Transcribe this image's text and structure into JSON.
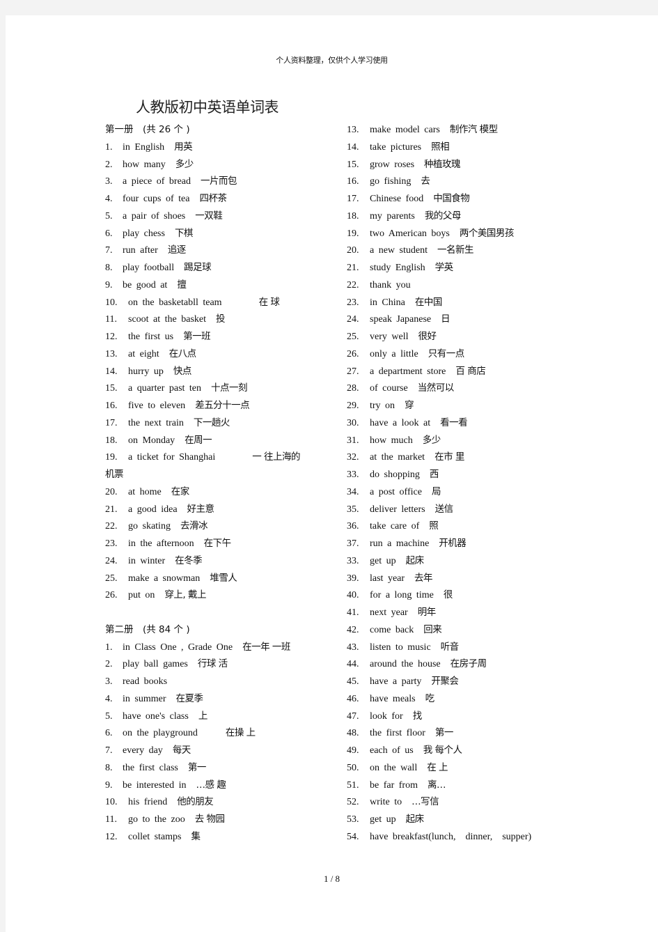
{
  "header_note": "个人资料整理，仅供个人学习使用",
  "title": "人教版初中英语单词表",
  "left_column": [
    {
      "type": "heading",
      "text": "第一册　(共 26 个 )"
    },
    {
      "type": "item",
      "num": "1.",
      "en": "in English",
      "zh": "用英"
    },
    {
      "type": "item",
      "num": "2.",
      "en": "how many",
      "zh": "多少"
    },
    {
      "type": "item",
      "num": "3.",
      "en": "a piece of bread",
      "zh": "一片而包"
    },
    {
      "type": "item",
      "num": "4.",
      "en": "four cups of tea",
      "zh": "四杯茶"
    },
    {
      "type": "item",
      "num": "5.",
      "en": "a pair of shoes",
      "zh": "一双鞋"
    },
    {
      "type": "item",
      "num": "6.",
      "en": "play chess",
      "zh": "下棋"
    },
    {
      "type": "item",
      "num": "7.",
      "en": "run after",
      "zh": "追逐"
    },
    {
      "type": "item",
      "num": "8.",
      "en": "play football",
      "zh": "踢足球"
    },
    {
      "type": "item",
      "num": "9.",
      "en": "be good at",
      "zh": "擅"
    },
    {
      "type": "item",
      "num": "10.",
      "en": "on the basketabll team",
      "zh": "　　　在 球"
    },
    {
      "type": "item",
      "num": "11.",
      "en": "scoot at the basket",
      "zh": "投"
    },
    {
      "type": "item",
      "num": "12.",
      "en": "the first us",
      "zh": "第一班"
    },
    {
      "type": "item",
      "num": "13.",
      "en": "at eight",
      "zh": "在八点"
    },
    {
      "type": "item",
      "num": "14.",
      "en": "hurry up",
      "zh": "快点"
    },
    {
      "type": "item",
      "num": "15.",
      "en": "a quarter past ten",
      "zh": "十点一刻"
    },
    {
      "type": "item",
      "num": "16.",
      "en": "five to eleven",
      "zh": "差五分十一点"
    },
    {
      "type": "item",
      "num": "17.",
      "en": "the next train",
      "zh": "下一趟火"
    },
    {
      "type": "item",
      "num": "18.",
      "en": "on Monday",
      "zh": "在周一"
    },
    {
      "type": "item",
      "num": "19.",
      "en": "a ticket for Shanghai",
      "zh": "　　　一 往上海的"
    },
    {
      "type": "continuation",
      "text": "机票"
    },
    {
      "type": "item",
      "num": "20.",
      "en": "at home",
      "zh": "在家"
    },
    {
      "type": "item",
      "num": "21.",
      "en": "a good idea",
      "zh": "好主意"
    },
    {
      "type": "item",
      "num": "22.",
      "en": "go skating",
      "zh": "去滑冰"
    },
    {
      "type": "item",
      "num": "23.",
      "en": "in the afternoon",
      "zh": "在下午"
    },
    {
      "type": "item",
      "num": "24.",
      "en": "in winter",
      "zh": "在冬季"
    },
    {
      "type": "item",
      "num": "25.",
      "en": "make a snowman",
      "zh": "堆雪人"
    },
    {
      "type": "item",
      "num": "26.",
      "en": "put on",
      "zh": "穿上, 戴上"
    },
    {
      "type": "blank",
      "text": ""
    },
    {
      "type": "heading",
      "text": "第二册　(共 84 个 )"
    },
    {
      "type": "item",
      "num": "1.",
      "en": "in Class One , Grade One",
      "zh": "在一年 一班"
    },
    {
      "type": "item",
      "num": "2.",
      "en": "play ball games",
      "zh": "行球 活"
    },
    {
      "type": "item",
      "num": "3.",
      "en": "read books",
      "zh": ""
    },
    {
      "type": "item",
      "num": "4.",
      "en": "in summer",
      "zh": "在夏季"
    },
    {
      "type": "item",
      "num": "5.",
      "en": "have one's class",
      "zh": "上"
    },
    {
      "type": "item",
      "num": "6.",
      "en": "on the playground",
      "zh": "　　在操 上"
    },
    {
      "type": "item",
      "num": "7.",
      "en": "every day",
      "zh": "每天"
    },
    {
      "type": "item",
      "num": "8.",
      "en": "the first class",
      "zh": "第一"
    },
    {
      "type": "item",
      "num": "9.",
      "en": "be interested in",
      "zh": "…感 趣"
    },
    {
      "type": "item",
      "num": "10.",
      "en": "his friend",
      "zh": "他的朋友"
    },
    {
      "type": "item",
      "num": "11.",
      "en": "go to the zoo",
      "zh": "去 物园"
    },
    {
      "type": "item",
      "num": "12.",
      "en": "collet stamps",
      "zh": "集"
    }
  ],
  "right_column": [
    {
      "type": "item",
      "num": "13.",
      "en": "make model cars",
      "zh": "制作汽 模型"
    },
    {
      "type": "item",
      "num": "14.",
      "en": "take pictures",
      "zh": "照相"
    },
    {
      "type": "item",
      "num": "15.",
      "en": "grow roses",
      "zh": "种植玫瑰"
    },
    {
      "type": "item",
      "num": "16.",
      "en": "go fishing",
      "zh": "去"
    },
    {
      "type": "item",
      "num": "17.",
      "en": "Chinese food",
      "zh": "中国食物"
    },
    {
      "type": "item",
      "num": "18.",
      "en": "my parents",
      "zh": "我的父母"
    },
    {
      "type": "item",
      "num": "19.",
      "en": "two American boys",
      "zh": "两个美国男孩"
    },
    {
      "type": "item",
      "num": "20.",
      "en": "a new student",
      "zh": "一名新生"
    },
    {
      "type": "item",
      "num": "21.",
      "en": "study English",
      "zh": "学英"
    },
    {
      "type": "item",
      "num": "22.",
      "en": "thank you",
      "zh": ""
    },
    {
      "type": "item",
      "num": "23.",
      "en": "in China",
      "zh": "在中国"
    },
    {
      "type": "item",
      "num": "24.",
      "en": "speak Japanese",
      "zh": "日"
    },
    {
      "type": "item",
      "num": "25.",
      "en": "very well",
      "zh": "很好"
    },
    {
      "type": "item",
      "num": "26.",
      "en": "only a little",
      "zh": "只有一点"
    },
    {
      "type": "item",
      "num": "27.",
      "en": "a department store",
      "zh": "百 商店"
    },
    {
      "type": "item",
      "num": "28.",
      "en": "of course",
      "zh": "当然可以"
    },
    {
      "type": "item",
      "num": "29.",
      "en": "try on",
      "zh": "穿"
    },
    {
      "type": "item",
      "num": "30.",
      "en": "have a look at",
      "zh": "看一看"
    },
    {
      "type": "item",
      "num": "31.",
      "en": "how much",
      "zh": "多少"
    },
    {
      "type": "item",
      "num": "32.",
      "en": "at the market",
      "zh": "在市 里"
    },
    {
      "type": "item",
      "num": "33.",
      "en": "do shopping",
      "zh": "西"
    },
    {
      "type": "item",
      "num": "34.",
      "en": "a post office",
      "zh": "局"
    },
    {
      "type": "item",
      "num": "35.",
      "en": "deliver letters",
      "zh": "送信"
    },
    {
      "type": "item",
      "num": "36.",
      "en": "take care of",
      "zh": "照"
    },
    {
      "type": "item",
      "num": "37.",
      "en": "run a machine",
      "zh": "开机器"
    },
    {
      "type": "item",
      "num": "33.",
      "en": "get up",
      "zh": "起床"
    },
    {
      "type": "item",
      "num": "39.",
      "en": "last year",
      "zh": "去年"
    },
    {
      "type": "item",
      "num": "40.",
      "en": "for a long time",
      "zh": "很"
    },
    {
      "type": "item",
      "num": "41.",
      "en": "next year",
      "zh": "明年"
    },
    {
      "type": "item",
      "num": "42.",
      "en": "come back",
      "zh": "回来"
    },
    {
      "type": "item",
      "num": "43.",
      "en": "listen to music",
      "zh": "听音"
    },
    {
      "type": "item",
      "num": "44.",
      "en": "around the house",
      "zh": "在房子周"
    },
    {
      "type": "item",
      "num": "45.",
      "en": "have a party",
      "zh": "开聚会"
    },
    {
      "type": "item",
      "num": "46.",
      "en": "have meals",
      "zh": "吃"
    },
    {
      "type": "item",
      "num": "47.",
      "en": "look for",
      "zh": "找"
    },
    {
      "type": "item",
      "num": "48.",
      "en": "the first floor",
      "zh": "第一"
    },
    {
      "type": "item",
      "num": "49.",
      "en": "each of us",
      "zh": "我 每个人"
    },
    {
      "type": "item",
      "num": "50.",
      "en": "on the wall",
      "zh": "在 上"
    },
    {
      "type": "item",
      "num": "51.",
      "en": "be far from",
      "zh": "离…"
    },
    {
      "type": "item",
      "num": "52.",
      "en": "write to",
      "zh": "…写信"
    },
    {
      "type": "item",
      "num": "53.",
      "en": "get up",
      "zh": "起床"
    },
    {
      "type": "item",
      "num": "54.",
      "en": "have breakfast(lunch,　dinner,　supper)",
      "zh": ""
    }
  ],
  "page_indicator": "1 / 8"
}
